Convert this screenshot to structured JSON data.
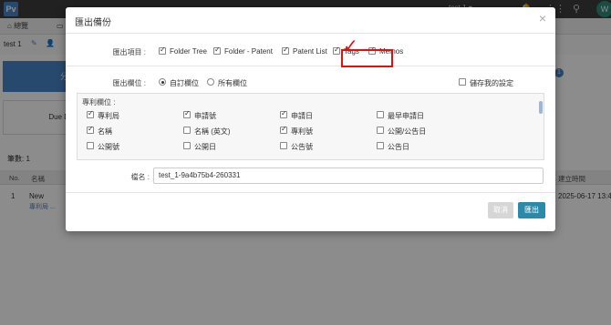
{
  "app": {
    "logo": "Pv",
    "user": "test 1 ▾",
    "avatar": "W"
  },
  "tabs": [
    {
      "label": "總覽"
    },
    {
      "label": "專利"
    }
  ],
  "project": {
    "name": "test 1"
  },
  "bg": {
    "blue_button": "分",
    "due_card": "Due D",
    "badge": "1",
    "count_label": "筆數: 1",
    "grid_headers": {
      "no": "No.",
      "name": "名稱",
      "created": "建立時間"
    },
    "row": {
      "no": "1",
      "name": "New",
      "sub": "專利局 ...",
      "date": "2025-06-17 13:48"
    }
  },
  "modal": {
    "title": "匯出備份",
    "export_items": {
      "label": "匯出項目 :",
      "items": [
        {
          "label": "Folder Tree",
          "checked": true
        },
        {
          "label": "Folder - Patent",
          "checked": true
        },
        {
          "label": "Patent List",
          "checked": true
        },
        {
          "label": "Tags",
          "checked": true
        },
        {
          "label": "Memos",
          "checked": true
        }
      ]
    },
    "export_fields": {
      "label": "匯出欄位 :",
      "options": [
        {
          "label": "自訂欄位",
          "selected": true
        },
        {
          "label": "所有欄位",
          "selected": false
        }
      ],
      "save_settings": {
        "label": "儲存我的設定",
        "checked": false
      }
    },
    "patent_fields": {
      "title": "專利欄位 :",
      "rows": [
        [
          {
            "label": "專利局",
            "checked": true
          },
          {
            "label": "申請號",
            "checked": true
          },
          {
            "label": "申請日",
            "checked": true
          },
          {
            "label": "最早申請日",
            "checked": false
          }
        ],
        [
          {
            "label": "名稱",
            "checked": true
          },
          {
            "label": "名稱 (英文)",
            "checked": false
          },
          {
            "label": "專利號",
            "checked": true
          },
          {
            "label": "公開/公告日",
            "checked": false
          }
        ],
        [
          {
            "label": "公開號",
            "checked": false
          },
          {
            "label": "公開日",
            "checked": false
          },
          {
            "label": "公告號",
            "checked": false
          },
          {
            "label": "公告日",
            "checked": false
          }
        ]
      ]
    },
    "filename": {
      "label": "檔名 :",
      "value": "test_1-9a4b75b4-260331"
    },
    "buttons": {
      "cancel": "取消",
      "export": "匯出"
    }
  }
}
